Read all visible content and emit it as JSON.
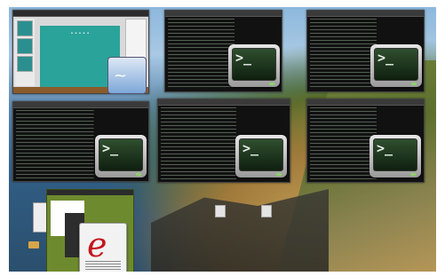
{
  "overview": {
    "windows": [
      {
        "kind": "presentation",
        "icon": "impress-icon"
      },
      {
        "kind": "terminal",
        "icon": "terminal-icon",
        "prompt": ">_"
      },
      {
        "kind": "terminal",
        "icon": "terminal-icon",
        "prompt": ">_"
      },
      {
        "kind": "terminal",
        "icon": "terminal-icon",
        "prompt": ">_"
      },
      {
        "kind": "terminal",
        "icon": "terminal-icon",
        "prompt": ">_"
      },
      {
        "kind": "terminal",
        "icon": "terminal-icon",
        "prompt": ">_"
      },
      {
        "kind": "text-editor",
        "icon": "text-editor-icon",
        "glyph": "e"
      }
    ]
  },
  "colors": {
    "accent_terminal_led": "#8fd16a",
    "slide_teal": "#2aa39a",
    "editor_red": "#c4161c"
  }
}
